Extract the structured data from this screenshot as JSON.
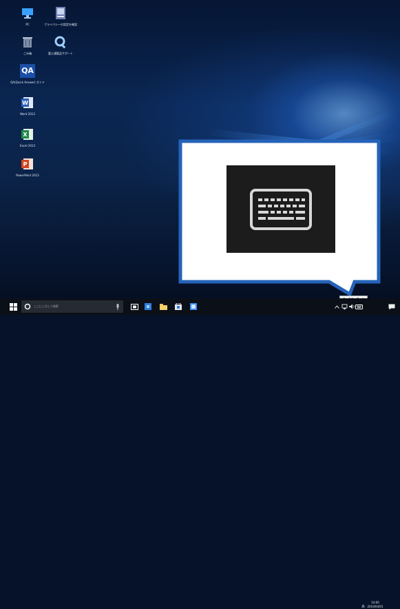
{
  "desktop": {
    "icons": [
      {
        "label": "PC"
      },
      {
        "label": "プライバシーの設定を確認"
      },
      {
        "label": "ごみ箱"
      },
      {
        "label": "富士通製品サポート"
      },
      {
        "label": "QA(Quick Answer) ガイド"
      },
      {
        "label": "Word 2013"
      },
      {
        "label": "Excel 2013"
      },
      {
        "label": "PowerPoint 2013"
      }
    ]
  },
  "callout": {
    "icon": "keyboard-icon"
  },
  "taskbar": {
    "search_placeholder": "ここに入力して検索",
    "ime_tooltip": "タッチキーボード",
    "ime_indicator": "あ",
    "clock_time": "14:00",
    "clock_date": "2016/04/01"
  },
  "colors": {
    "callout_border": "#2563b8",
    "tile_bg": "#1c1c1c",
    "taskbar_bg": "#0b0f17"
  }
}
